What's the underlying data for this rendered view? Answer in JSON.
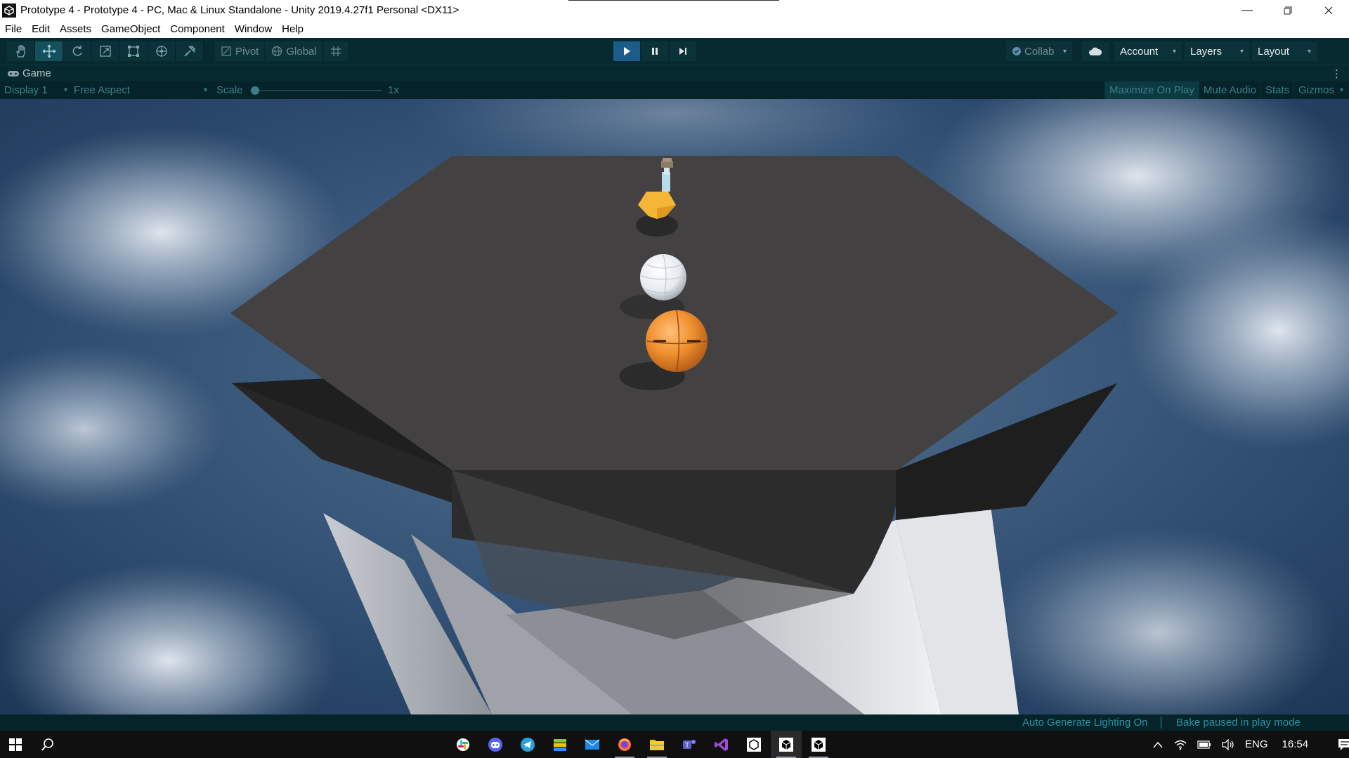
{
  "window": {
    "title": "Prototype 4 - Prototype 4 - PC, Mac & Linux Standalone - Unity 2019.4.27f1 Personal <DX11>",
    "minimize_icon": "minimize-icon",
    "maximize_icon": "restore-icon",
    "close_icon": "close-icon"
  },
  "menu": [
    "File",
    "Edit",
    "Assets",
    "GameObject",
    "Component",
    "Window",
    "Help"
  ],
  "toolbar": {
    "tools": [
      "hand-tool-icon",
      "move-tool-icon",
      "rotate-tool-icon",
      "scale-tool-icon",
      "rect-tool-icon",
      "transform-tool-icon",
      "custom-tool-icon"
    ],
    "active_tool": "move-tool-icon",
    "pivot_label": "Pivot",
    "global_label": "Global",
    "play_active": true,
    "collab_label": "Collab",
    "account_label": "Account",
    "layers_label": "Layers",
    "layout_label": "Layout"
  },
  "game_tab": {
    "label": "Game",
    "display": "Display 1",
    "aspect": "Free Aspect",
    "scale_label": "Scale",
    "scale_value": "1x",
    "maximize_on_play": "Maximize On Play",
    "mute_audio": "Mute Audio",
    "stats": "Stats",
    "gizmos": "Gizmos"
  },
  "status": {
    "lighting": "Auto Generate Lighting On",
    "bake": "Bake paused in play mode"
  },
  "taskbar": {
    "apps": [
      "slack-icon",
      "discord-icon",
      "telegram-icon",
      "bluestacks-icon",
      "mail-icon",
      "firefox-icon",
      "file-explorer-icon",
      "teams-icon",
      "visual-studio-icon",
      "unity-hub-icon",
      "unity-editor-icon",
      "unity-editor-icon"
    ],
    "language": "ENG",
    "time": "16:54"
  },
  "colors": {
    "toolbar_bg": "#062a30",
    "accent_play": "#1c5c8a",
    "status_text": "#2f8fa0",
    "platform_top": "#434141",
    "player_orange": "#f0902e"
  }
}
